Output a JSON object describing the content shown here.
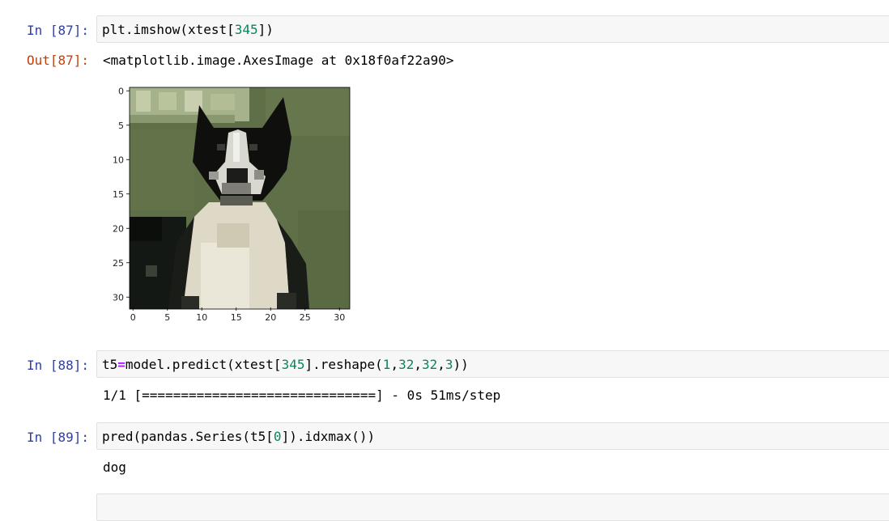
{
  "cells": [
    {
      "in_prompt": "In [87]:",
      "out_prompt": "Out[87]:",
      "code": {
        "a": "plt.imshow(xtest[",
        "n1": "345",
        "b": "])"
      },
      "output": "<matplotlib.image.AxesImage at 0x18f0af22a90>"
    },
    {
      "in_prompt": "In [88]:",
      "code": {
        "a": "t5",
        "op": "=",
        "b": "model.predict(xtest[",
        "n1": "345",
        "c": "].reshape(",
        "n2": "1",
        "d": ",",
        "n3": "32",
        "e": ",",
        "n4": "32",
        "f": ",",
        "n5": "3",
        "g": "))"
      },
      "output": "1/1 [==============================] - 0s 51ms/step"
    },
    {
      "in_prompt": "In [89]:",
      "code": {
        "a": "pred(pandas.Series(t5[",
        "n1": "0",
        "b": "]).idxmax())"
      },
      "output": "dog"
    }
  ],
  "plot": {
    "x_ticks": [
      "0",
      "5",
      "10",
      "15",
      "20",
      "25",
      "30"
    ],
    "y_ticks": [
      "0",
      "5",
      "10",
      "15",
      "20",
      "25",
      "30"
    ]
  }
}
